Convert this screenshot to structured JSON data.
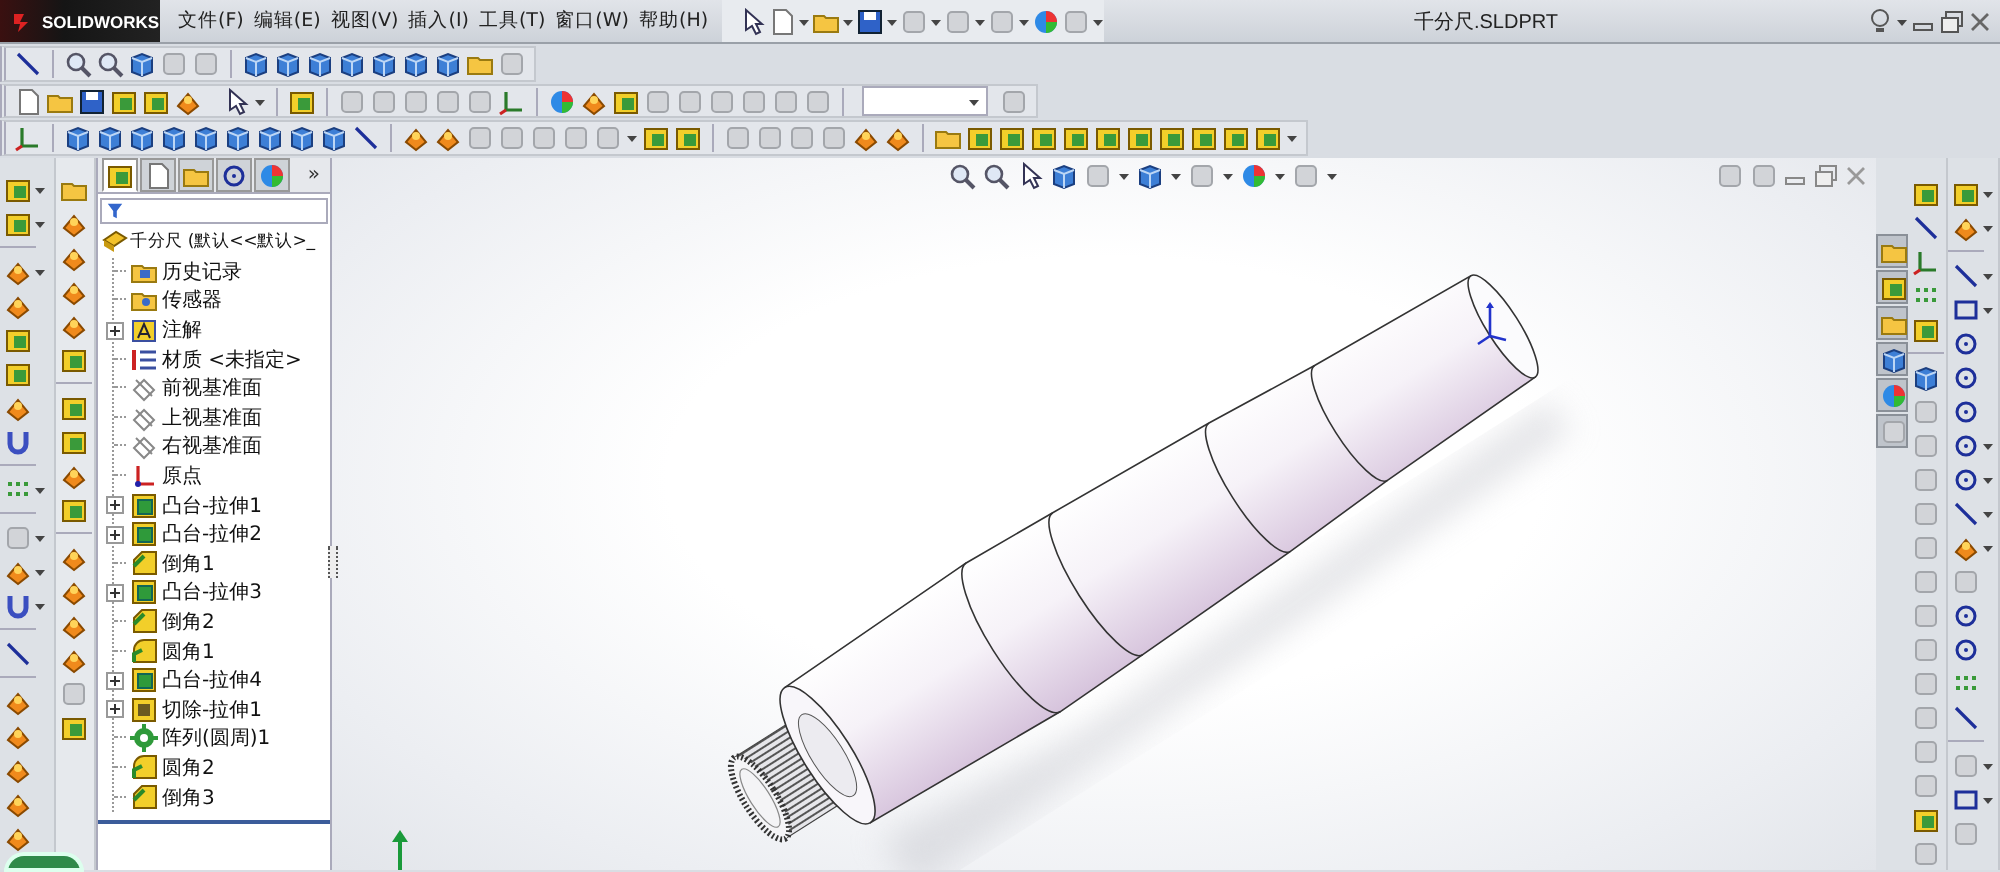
{
  "app": {
    "logo_text": "SOLIDWORKS"
  },
  "menu": [
    "文件(F)",
    "编辑(E)",
    "视图(V)",
    "插入(I)",
    "工具(T)",
    "窗口(W)",
    "帮助(H)"
  ],
  "window": {
    "title": "千分尺.SLDPRT"
  },
  "tree_tabs": [
    {
      "kind": "features",
      "selected": true
    },
    {
      "kind": "properties",
      "selected": false
    },
    {
      "kind": "config",
      "selected": false
    },
    {
      "kind": "dimxpert",
      "selected": false
    },
    {
      "kind": "display",
      "selected": false
    }
  ],
  "tree_more": "»",
  "tree": {
    "label": "千分尺  (默认<<默认>_",
    "kind": "part",
    "children": [
      {
        "label": "历史记录",
        "kind": "history",
        "expander": false
      },
      {
        "label": "传感器",
        "kind": "sensor",
        "expander": false
      },
      {
        "label": "注解",
        "kind": "annotation",
        "expander": true
      },
      {
        "label": "材质 <未指定>",
        "kind": "material",
        "expander": false
      },
      {
        "label": "前视基准面",
        "kind": "plane",
        "expander": false
      },
      {
        "label": "上视基准面",
        "kind": "plane",
        "expander": false
      },
      {
        "label": "右视基准面",
        "kind": "plane",
        "expander": false
      },
      {
        "label": "原点",
        "kind": "origin",
        "expander": false
      },
      {
        "label": "凸台-拉伸1",
        "kind": "boss",
        "expander": true
      },
      {
        "label": "凸台-拉伸2",
        "kind": "boss",
        "expander": true
      },
      {
        "label": "倒角1",
        "kind": "chamfer",
        "expander": false
      },
      {
        "label": "凸台-拉伸3",
        "kind": "boss",
        "expander": true
      },
      {
        "label": "倒角2",
        "kind": "chamfer",
        "expander": false
      },
      {
        "label": "圆角1",
        "kind": "fillet",
        "expander": false
      },
      {
        "label": "凸台-拉伸4",
        "kind": "boss",
        "expander": true
      },
      {
        "label": "切除-拉伸1",
        "kind": "cut",
        "expander": true
      },
      {
        "label": "阵列(圆周)1",
        "kind": "pattern",
        "expander": false
      },
      {
        "label": "圆角2",
        "kind": "fillet",
        "expander": false
      },
      {
        "label": "倒角3",
        "kind": "chamfer",
        "expander": false
      }
    ]
  }
}
